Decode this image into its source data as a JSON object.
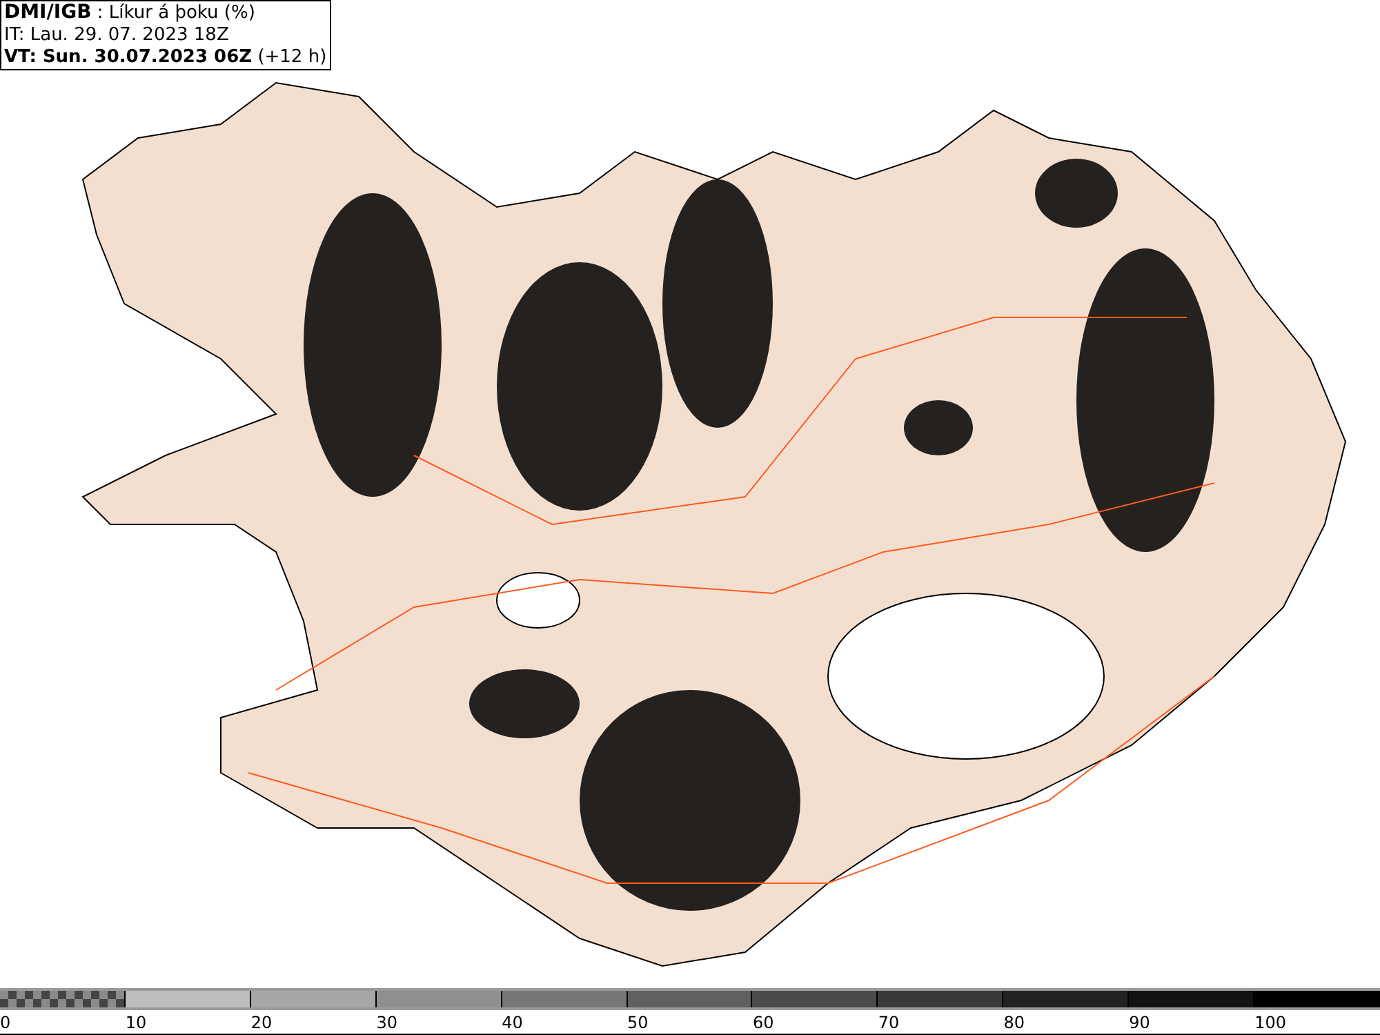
{
  "header": {
    "source": "DMI/IGB",
    "title": " : Líkur á þoku (%)",
    "issue_time": "IT: Lau. 29. 07. 2023 18Z",
    "valid_label": "VT: Sun. 30.07.2023 06Z",
    "lead": " (+12 h)"
  },
  "legend": {
    "bins": [
      {
        "kind": "checker",
        "color": "#8a8a8a"
      },
      {
        "kind": "solid",
        "color": "#bdbdbd"
      },
      {
        "kind": "solid",
        "color": "#a6a6a6"
      },
      {
        "kind": "solid",
        "color": "#8f8f8f"
      },
      {
        "kind": "solid",
        "color": "#777777"
      },
      {
        "kind": "solid",
        "color": "#606060"
      },
      {
        "kind": "solid",
        "color": "#4b4b4b"
      },
      {
        "kind": "solid",
        "color": "#393939"
      },
      {
        "kind": "solid",
        "color": "#222222"
      },
      {
        "kind": "solid",
        "color": "#121212"
      },
      {
        "kind": "solid",
        "color": "#000000"
      }
    ],
    "ticks": [
      "0",
      "10",
      "20",
      "30",
      "40",
      "50",
      "60",
      "70",
      "80",
      "90",
      "100"
    ]
  }
}
